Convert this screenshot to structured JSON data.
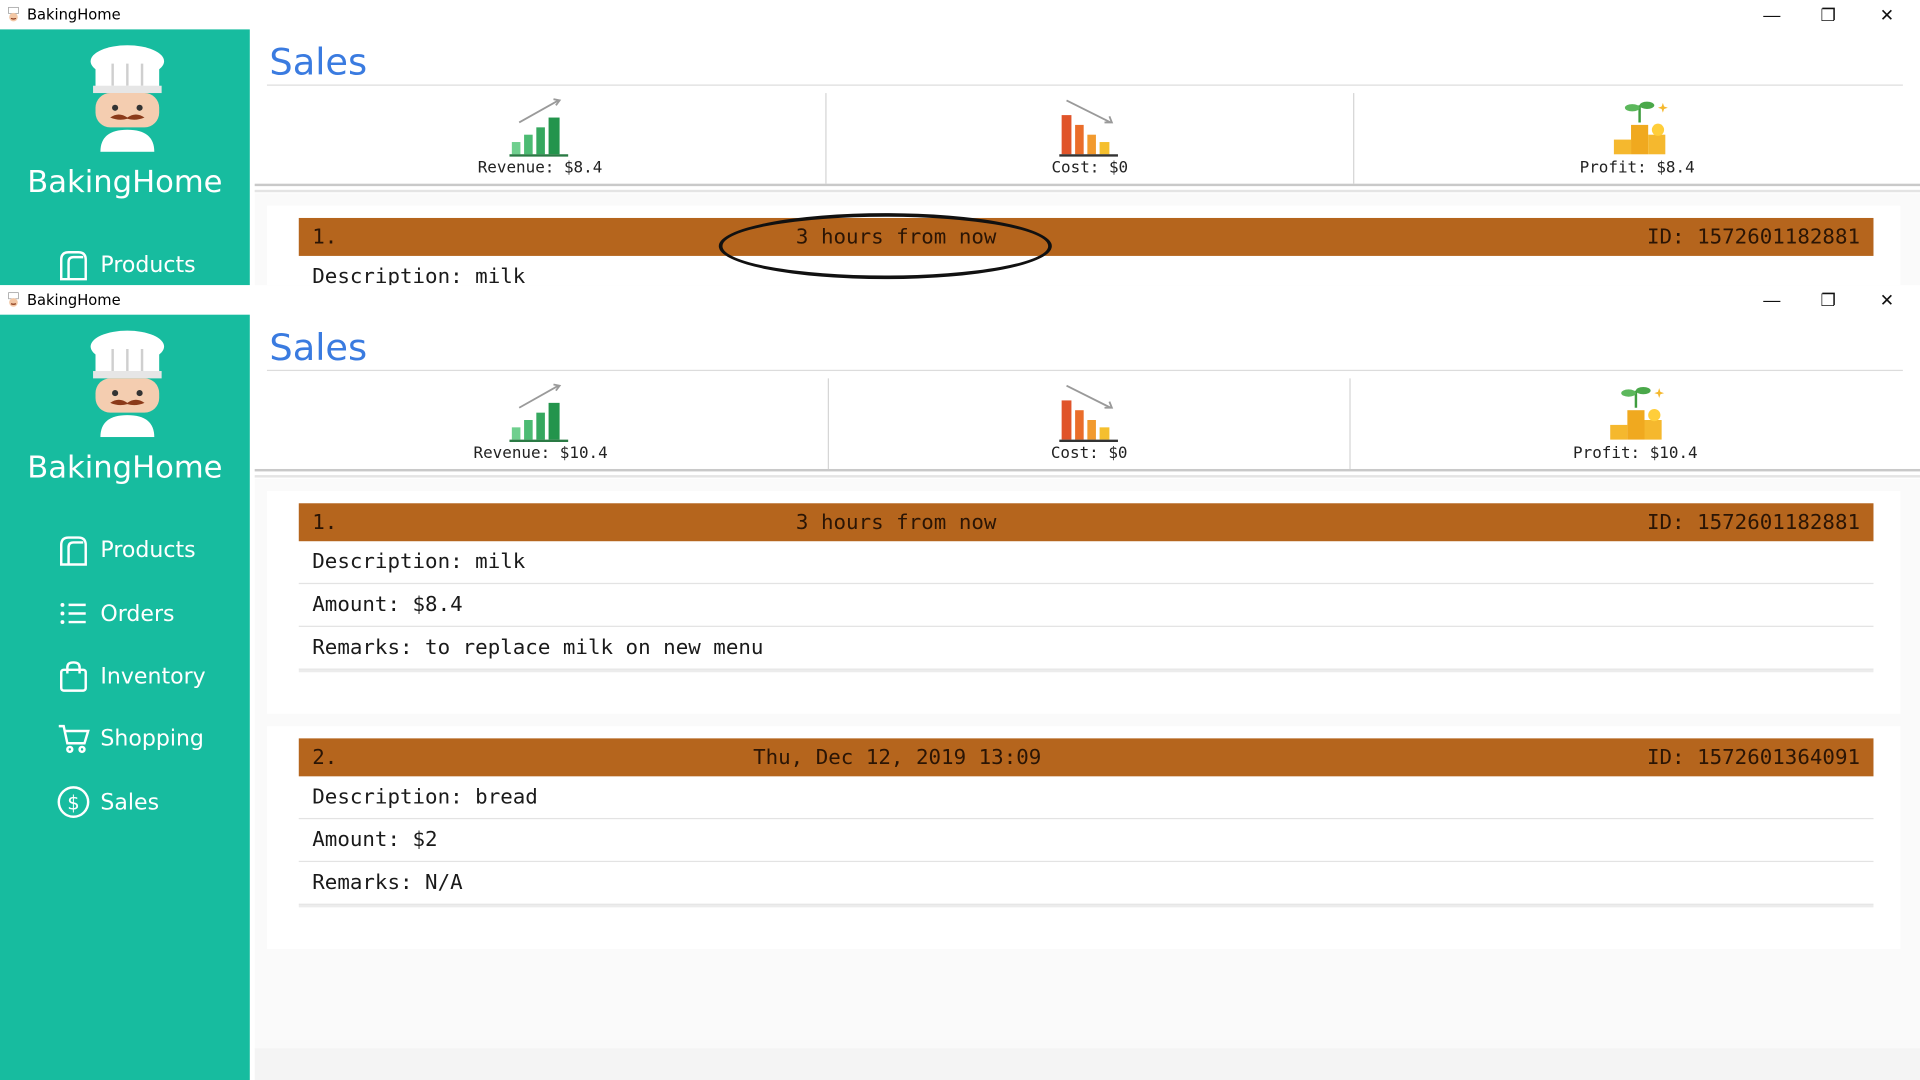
{
  "window": {
    "title": "BakingHome",
    "controls": {
      "minimize": "—",
      "maximize": "❐",
      "close": "✕"
    }
  },
  "sidebar": {
    "brand": "BakingHome",
    "items": [
      {
        "label": "Products",
        "icon": "products-icon"
      },
      {
        "label": "Orders",
        "icon": "orders-list-icon"
      },
      {
        "label": "Inventory",
        "icon": "shopping-bag-icon"
      },
      {
        "label": "Shopping",
        "icon": "cart-icon"
      },
      {
        "label": "Sales",
        "icon": "dollar-circle-icon"
      }
    ]
  },
  "top_window": {
    "page_title": "Sales",
    "stats": {
      "revenue": "Revenue: $8.4",
      "cost": "Cost: $0",
      "profit": "Profit: $8.4"
    },
    "record": {
      "index": "1.",
      "time": "3 hours from now",
      "id": "ID: 1572601182881",
      "description": "Description: milk"
    }
  },
  "main_window": {
    "page_title": "Sales",
    "stats": {
      "revenue": "Revenue: $10.4",
      "cost": "Cost: $0",
      "profit": "Profit: $10.4"
    },
    "records": [
      {
        "index": "1.",
        "time": "3 hours from now",
        "id": "ID: 1572601182881",
        "description": "Description: milk",
        "amount": "Amount: $8.4",
        "remarks": "Remarks: to replace milk on new menu"
      },
      {
        "index": "2.",
        "time": "Thu, Dec 12, 2019 13:09",
        "id": "ID: 1572601364091",
        "description": "Description: bread",
        "amount": "Amount: $2",
        "remarks": "Remarks: N/A"
      }
    ]
  },
  "colors": {
    "sidebar": "#17bc9f",
    "title": "#3a7be0",
    "record_header": "#b5651d"
  }
}
